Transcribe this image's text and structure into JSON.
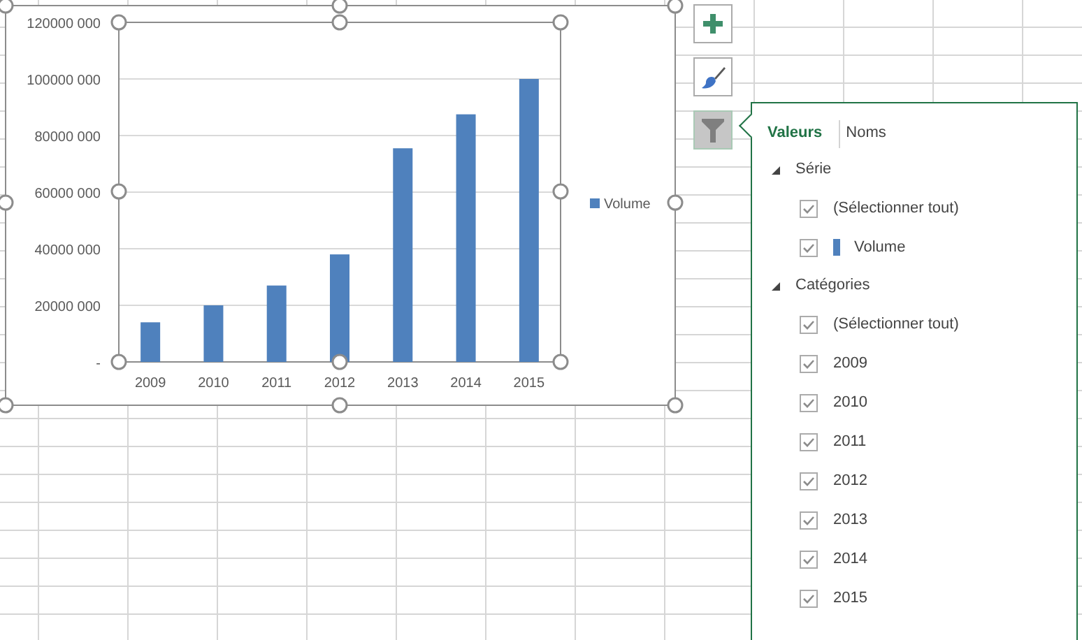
{
  "chart": {
    "chart_data": {
      "type": "bar",
      "categories": [
        "2009",
        "2010",
        "2011",
        "2012",
        "2013",
        "2014",
        "2015"
      ],
      "series": [
        {
          "name": "Volume",
          "color": "#4f81bd",
          "values": [
            14000000,
            20000000,
            27000000,
            38000000,
            75500000,
            87500000,
            100000000
          ]
        }
      ],
      "ylim": [
        0,
        120000000
      ],
      "grid": true,
      "yticks": [
        {
          "value": 0,
          "label": "-"
        },
        {
          "value": 20000000,
          "label": "20000 000"
        },
        {
          "value": 40000000,
          "label": "40000 000"
        },
        {
          "value": 60000000,
          "label": "60000 000"
        },
        {
          "value": 80000000,
          "label": "80000 000"
        },
        {
          "value": 100000000,
          "label": "100000 000"
        },
        {
          "value": 120000000,
          "label": "120000 000"
        }
      ]
    }
  },
  "chart_buttons": [
    {
      "kind": "add",
      "selected": false
    },
    {
      "kind": "style",
      "selected": false
    },
    {
      "kind": "filter",
      "selected": true
    }
  ],
  "filter_panel": {
    "tabs": [
      {
        "label": "Valeurs",
        "selected": true
      },
      {
        "label": "Noms",
        "selected": false
      }
    ],
    "sections": [
      {
        "title": "Série",
        "expanded": true,
        "items": [
          {
            "label": "(Sélectionner tout)",
            "checked": true
          },
          {
            "label": "Volume",
            "checked": true,
            "color": "#4f81bd"
          }
        ]
      },
      {
        "title": "Catégories",
        "expanded": true,
        "items": [
          {
            "label": "(Sélectionner tout)",
            "checked": true
          },
          {
            "label": "2009",
            "checked": true
          },
          {
            "label": "2010",
            "checked": true
          },
          {
            "label": "2011",
            "checked": true
          },
          {
            "label": "2012",
            "checked": true
          },
          {
            "label": "2013",
            "checked": true
          },
          {
            "label": "2014",
            "checked": true
          },
          {
            "label": "2015",
            "checked": true
          }
        ]
      }
    ]
  }
}
